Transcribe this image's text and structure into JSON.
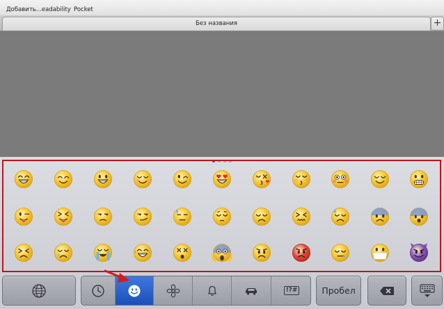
{
  "browser": {
    "bookmarks": [
      "Добавить...eadability",
      "Pocket"
    ],
    "tab_title": "Без названия",
    "new_tab_label": "+"
  },
  "keyboard": {
    "page_dots": 4,
    "active_page": 0,
    "emoji_rows": [
      [
        "grin",
        "smile",
        "smiley",
        "relaxed",
        "wink",
        "heart-eyes",
        "kissing-heart",
        "kissing-closed-eyes",
        "flushed",
        "relieved",
        "grimacing"
      ],
      [
        "tongue-wink",
        "tongue-closed-eyes",
        "unamused",
        "smirk",
        "sweat",
        "pensive",
        "disappointed",
        "confounded",
        "disappointed-relieved",
        "cold-sweat",
        "fearful"
      ],
      [
        "persevere",
        "cry",
        "sob",
        "joy",
        "astonished",
        "scream",
        "angry",
        "rage",
        "sleepy",
        "mask",
        "smiling-imp"
      ]
    ],
    "categories": [
      {
        "icon": "clock-icon",
        "label": ""
      },
      {
        "icon": "smiley-icon",
        "label": ""
      },
      {
        "icon": "flower-icon",
        "label": ""
      },
      {
        "icon": "bell-icon",
        "label": ""
      },
      {
        "icon": "car-icon",
        "label": ""
      },
      {
        "icon": "symbols-icon",
        "label": "!?#"
      }
    ],
    "active_category": 1,
    "globe_icon": "globe-icon",
    "space_label": "Пробел",
    "delete_icon": "backspace-icon",
    "hide_icon": "keyboard-hide-icon"
  },
  "colors": {
    "highlight_border": "#c0131a",
    "active_category": "#2a63cc",
    "emoji_face": "#f6c631",
    "content_bg": "#7b7b7b"
  }
}
